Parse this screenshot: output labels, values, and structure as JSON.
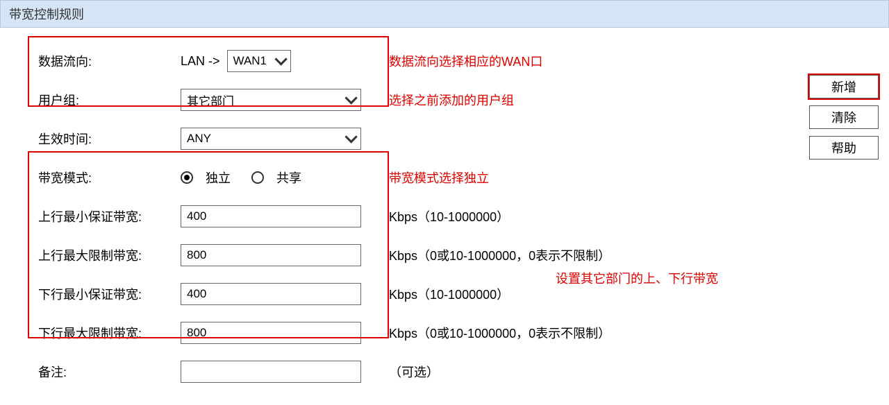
{
  "header": {
    "title": "带宽控制规则"
  },
  "form": {
    "data_direction": {
      "label": "数据流向:",
      "prefix": "LAN ->",
      "value": "WAN1"
    },
    "user_group": {
      "label": "用户组:",
      "value": "其它部门"
    },
    "effective_time": {
      "label": "生效时间:",
      "value": "ANY"
    },
    "bandwidth_mode": {
      "label": "带宽模式:",
      "options": [
        {
          "label": "独立",
          "checked": true
        },
        {
          "label": "共享",
          "checked": false
        }
      ]
    },
    "up_min": {
      "label": "上行最小保证带宽:",
      "value": "400",
      "hint": "Kbps（10-1000000）"
    },
    "up_max": {
      "label": "上行最大限制带宽:",
      "value": "800",
      "hint": "Kbps（0或10-1000000，0表示不限制）"
    },
    "down_min": {
      "label": "下行最小保证带宽:",
      "value": "400",
      "hint": "Kbps（10-1000000）"
    },
    "down_max": {
      "label": "下行最大限制带宽:",
      "value": "800",
      "hint": "Kbps（0或10-1000000，0表示不限制）"
    },
    "remark": {
      "label": "备注:",
      "value": "",
      "hint": "（可选）"
    }
  },
  "notes": {
    "direction": "数据流向选择相应的WAN口",
    "group": "选择之前添加的用户组",
    "mode": "带宽模式选择独立",
    "bandwidth": "设置其它部门的上、下行带宽"
  },
  "buttons": {
    "add": "新增",
    "clear": "清除",
    "help": "帮助"
  }
}
